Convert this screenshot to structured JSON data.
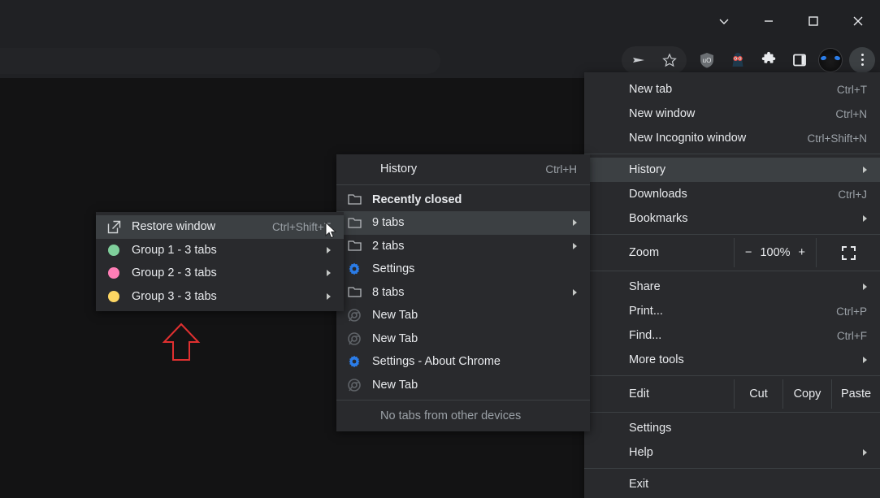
{
  "window": {
    "controls": [
      {
        "name": "chevron-down",
        "label": "⌄"
      },
      {
        "name": "minimize",
        "label": "—"
      },
      {
        "name": "maximize",
        "label": "□"
      },
      {
        "name": "close",
        "label": "✕"
      }
    ]
  },
  "toolbar": {
    "omnibox_value": "",
    "omnibox_placeholder": "",
    "icons": [
      {
        "name": "share-send-icon",
        "label": "send"
      },
      {
        "name": "bookmark-star-icon",
        "label": "star"
      },
      {
        "name": "ublock-origin-icon",
        "label": "uO"
      },
      {
        "name": "extension-character-icon",
        "label": "mascot"
      },
      {
        "name": "extensions-puzzle-icon",
        "label": "puzzle"
      },
      {
        "name": "side-panel-icon",
        "label": "side panel"
      },
      {
        "name": "profile-avatar",
        "label": "profile"
      },
      {
        "name": "chrome-menu-icon",
        "label": "⋮"
      }
    ]
  },
  "main_menu": {
    "items": [
      {
        "label": "New tab",
        "accel": "Ctrl+T",
        "arrow": false,
        "name": "menu-item-new-tab"
      },
      {
        "label": "New window",
        "accel": "Ctrl+N",
        "arrow": false,
        "name": "menu-item-new-window"
      },
      {
        "label": "New Incognito window",
        "accel": "Ctrl+Shift+N",
        "arrow": false,
        "name": "menu-item-new-incognito-window"
      }
    ],
    "items2": [
      {
        "label": "History",
        "accel": "",
        "arrow": true,
        "highlight": true,
        "name": "menu-item-history"
      },
      {
        "label": "Downloads",
        "accel": "Ctrl+J",
        "arrow": false,
        "highlight": false,
        "name": "menu-item-downloads"
      },
      {
        "label": "Bookmarks",
        "accel": "",
        "arrow": true,
        "highlight": false,
        "name": "menu-item-bookmarks"
      }
    ],
    "zoom": {
      "label": "Zoom",
      "minus": "−",
      "level": "100%",
      "plus": "+"
    },
    "items3": [
      {
        "label": "Share",
        "accel": "",
        "arrow": true,
        "name": "menu-item-share"
      },
      {
        "label": "Print...",
        "accel": "Ctrl+P",
        "arrow": false,
        "name": "menu-item-print"
      },
      {
        "label": "Find...",
        "accel": "Ctrl+F",
        "arrow": false,
        "name": "menu-item-find"
      },
      {
        "label": "More tools",
        "accel": "",
        "arrow": true,
        "name": "menu-item-more-tools"
      }
    ],
    "edit": {
      "label": "Edit",
      "cut": "Cut",
      "copy": "Copy",
      "paste": "Paste"
    },
    "items4": [
      {
        "label": "Settings",
        "accel": "",
        "arrow": false,
        "name": "menu-item-settings"
      },
      {
        "label": "Help",
        "accel": "",
        "arrow": true,
        "name": "menu-item-help"
      }
    ],
    "exit": {
      "label": "Exit",
      "name": "menu-item-exit"
    }
  },
  "history_menu": {
    "header": {
      "label": "History",
      "accel": "Ctrl+H"
    },
    "section_title": "Recently closed",
    "items": [
      {
        "label": "9 tabs",
        "icon": "folder-icon",
        "arrow": true,
        "highlight": true,
        "name": "history-item-9-tabs"
      },
      {
        "label": "2 tabs",
        "icon": "folder-icon",
        "arrow": true,
        "highlight": false,
        "name": "history-item-2-tabs"
      },
      {
        "label": "Settings",
        "icon": "gear-icon",
        "arrow": false,
        "highlight": false,
        "name": "history-item-settings"
      },
      {
        "label": "8 tabs",
        "icon": "folder-icon",
        "arrow": true,
        "highlight": false,
        "name": "history-item-8-tabs"
      },
      {
        "label": "New Tab",
        "icon": "chrome-icon",
        "arrow": false,
        "highlight": false,
        "name": "history-item-new-tab-1"
      },
      {
        "label": "New Tab",
        "icon": "chrome-icon",
        "arrow": false,
        "highlight": false,
        "name": "history-item-new-tab-2"
      },
      {
        "label": "Settings - About Chrome",
        "icon": "gear-icon",
        "arrow": false,
        "highlight": false,
        "name": "history-item-settings-about-chrome"
      },
      {
        "label": "New Tab",
        "icon": "chrome-icon",
        "arrow": false,
        "highlight": false,
        "name": "history-item-new-tab-3"
      }
    ],
    "footer": "No tabs from other devices"
  },
  "groups_menu": {
    "restore": {
      "label": "Restore window",
      "accel": "Ctrl+Shift+T",
      "name": "groups-item-restore-window"
    },
    "groups": [
      {
        "label": "Group 1 - 3 tabs",
        "color": "#7fcf9b",
        "name": "groups-item-group-1"
      },
      {
        "label": "Group 2 - 3 tabs",
        "color": "#ff7eb6",
        "name": "groups-item-group-2"
      },
      {
        "label": "Group 3 - 3 tabs",
        "color": "#fdd663",
        "name": "groups-item-group-3"
      }
    ]
  },
  "annotation": {
    "arrow_color": "#e03030",
    "shape": "up-arrow"
  },
  "colors": {
    "menu_bg": "#292a2d",
    "menu_highlight": "#3c4043",
    "chrome_bg": "#202124",
    "page_bg": "#131314",
    "text": "#e8eaed",
    "dim_text": "#9aa0a6",
    "accent_blue": "#2b7de9"
  }
}
